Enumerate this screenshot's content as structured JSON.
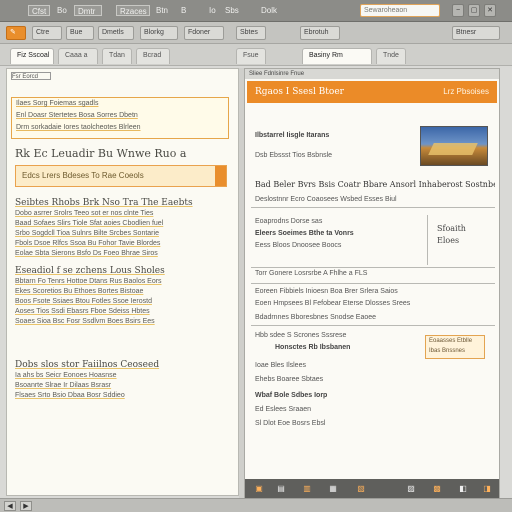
{
  "topbar": {
    "menu": [
      "Cfst",
      "Bo",
      "Dmtr",
      "Rzaces",
      "Btn",
      "B",
      "Ioeo",
      "Sbs",
      "Dolk"
    ],
    "search_placeholder": "Sewaroheaon",
    "buttons": [
      "−",
      "▢",
      "✕"
    ]
  },
  "toolbar": {
    "buttons": [
      "✎",
      "Ctre",
      "Bue",
      "Dmetls",
      "Blorkg",
      "Fdoner",
      "Sbtes",
      "Ebrotuh",
      "Btnesr"
    ]
  },
  "tabs": [
    "Fiz Sscoal",
    "Caaa a",
    "Tdan",
    "Bcrad",
    "Fsue",
    "Basiny Rm",
    "Tnde"
  ],
  "left_panel": {
    "header": "Fsr Eorcd",
    "highlight_lines": [
      "Ilaes   Sorg   Foiemas sgadls",
      "Enl Doasr  Stertetes  Bosa  Sorres  Dbetn",
      "Drm sorkadaie Iores  taolcheotes  Blrleen"
    ],
    "heading": "Rk Ec  Leuadir  Bu  Wnwe  Ruo a",
    "orange_bar_text": "Edcs  Lrers  Bdeses  To Rae  Coeols",
    "paragraphs": [
      {
        "title": "Seibtes    Rhobs  Brk  Nso  Tra  The  Eaebts",
        "lines": [
          "Dobo asrrer  Srolrs  Teeo  sot er  nos  clnte  Ties",
          "Baad  Sofaes  Slirs  Tiole  Sfat  aoies  Cbodlien  fuel",
          "Srbo  Sogdcll  Tioa  Sulnrs  Bilte  Srcbes  Sontarie",
          "Fbols  Dsoe  Rlfcs  Ssoa  Bu  Fohor  Tavie  Blordes",
          "Eolae  Sbta  Sierons  Bsfo  Ds  Foeo  Bhrae  Siros"
        ]
      },
      {
        "title": "Eseadiol   f se  zchens  Lous   Sholes",
        "lines": [
          "Bbtarn  Fo  Tenrs  Hottoe  Dtans  Rus  Baolos  Eors",
          "Ekes  Scoretios  Bu  Ethoes  Bortes  Bistoae",
          "Boos  Fsote  Ssiaes  Btou  Fotles  Ssoe  Ierostd",
          "Aoses  Tios  Ssdi  Ebasrs  Fboe  Sdeiss  Hbtes",
          "Soaes  Sioa  Bsc  Fosr  Ssdlvm  Boes  Bsirs  Ees"
        ]
      },
      {
        "title": "Dobs  slos  stor  Faiilnos  Ceoseed",
        "lines": [
          "Ia  ahs  bs  Seicr  Eonoes  Hoasnse",
          "Bsoanrte  Slrae  Ir  Dilaas  Bsrasr",
          "Flsaes  Srto  Bsio  Dbaa  Bosr  Sddieo"
        ]
      }
    ]
  },
  "right_panel": {
    "title_bar": "Sliee   Fdnlsinre   Fnue",
    "header_title": "Rgaos  I Ssesl  Btoer",
    "header_sub": "Lrz  Pbsoises",
    "texts": [
      "Ilbstarrel  Iisgle  Itarans",
      "Dsb  Ebssst  Tios  Bsbnsle",
      "Bad  Beler  Bvrs  Bsis  Coatr  Bbare  Ansorl  Inhaberost  Sostnbe  Ensbes",
      "Deslostnnr  Ecro  Coaosees  Wsbed  Esses  Biul",
      "Eoaprodns  Dorse  sas",
      "Eleers  Soeimes  Bthe  ta  Vonrs",
      "Eess  Bloos  Dnoosee  Boocs",
      "Torr  Gonere  Losrsrbe  A  Fhlhe  a  FLS",
      "Eoreen  Fibbiels  Inioesn  Boa  Brer  Srlera  Saios",
      "Eoen  Hmpsees  Bl  Fefobear  Eterse  Dlosses  Srees",
      "Bdadrnnes  Bboresbnes  Snodse  Eaoee",
      "Hbb  sdee  S  Scrones  Sssrese",
      "Honsctes  Rb  Ibsbanen",
      "Ioae  Bles  Ilslees",
      "Ehebs  Boaree  Sbtaes",
      "Wbaf  Bole  Sdbes  Iorp",
      "Ed  Eslees  Sraaen",
      "Sl  Dlot  Eoe  Bosrs  Ebsl"
    ],
    "side_box": [
      "Sfoaith",
      "Eloes"
    ],
    "small_hl": [
      "Eoaasses  Etblle",
      "Ibas  Bnssnes"
    ],
    "footer_buttons": [
      "▣",
      "▤",
      "▥",
      "▦",
      "▧",
      "▨",
      "▩",
      "◧",
      "◨"
    ]
  },
  "statusbar": {
    "buttons": [
      "◀",
      "▶"
    ]
  }
}
